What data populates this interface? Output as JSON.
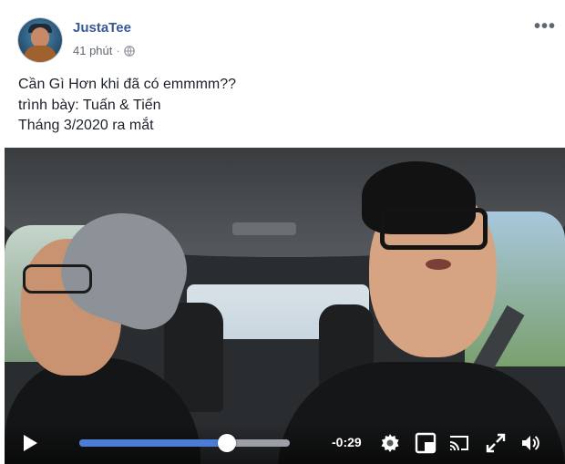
{
  "post": {
    "author": "JustaTee",
    "time": "41 phút",
    "separator": "·",
    "more_label": "•••",
    "text_lines": [
      "Cần Gì Hơn khi đã có emmmm??",
      "trình bày: Tuấn & Tiến",
      "Tháng 3/2020 ra mắt"
    ]
  },
  "video": {
    "time_remaining": "-0:29",
    "progress_fraction": 0.7,
    "accent_color": "#4b7cd6",
    "icons": [
      "play-icon",
      "gear-icon",
      "picture-in-picture-icon",
      "cast-icon",
      "fullscreen-icon",
      "volume-icon"
    ]
  },
  "colors": {
    "author": "#385898",
    "meta": "#616770",
    "text": "#1d2129"
  }
}
